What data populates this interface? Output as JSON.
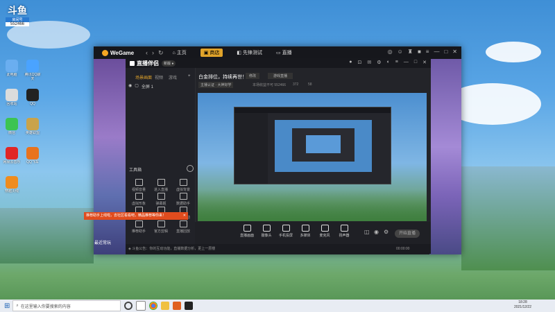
{
  "desktop": {
    "top_label": "斗鱼",
    "id_label": "房间号",
    "id_value": "552466",
    "icons": [
      {
        "label": "此电脑",
        "color": "#6aaef0"
      },
      {
        "label": "腾讯QQ聊天",
        "color": "#4aa3ff"
      },
      {
        "label": "回收站",
        "color": "#dcdcdc"
      },
      {
        "label": "QQ",
        "color": "#222222"
      },
      {
        "label": "微信",
        "color": "#3cc452"
      },
      {
        "label": "英雄联盟",
        "color": "#c9a34a"
      },
      {
        "label": "网易云音乐",
        "color": "#e02626"
      },
      {
        "label": "QQ飞车",
        "color": "#e8731e"
      },
      {
        "label": "穿越火线",
        "color": "#ef8c1e"
      }
    ],
    "right_badge": "斗鱼"
  },
  "wegame": {
    "logo": "WeGame",
    "tabs": [
      {
        "label": "主页",
        "active": false
      },
      {
        "label": "商店",
        "active": true
      },
      {
        "label": "先锋测试",
        "active": false
      },
      {
        "label": "直播",
        "active": false
      }
    ],
    "left_promo": "最近常玩"
  },
  "stream_app": {
    "logo": "直播伴侣",
    "badge": "新版 ●",
    "scene_tabs": [
      "场景画面",
      "视频",
      "游戏"
    ],
    "scene_item": "全屏 1",
    "stream_title": "白金排位，持续再世！",
    "edit_label": "修改",
    "category": "游戏直播",
    "room_info": "主播认证 · 大神好学",
    "stats": [
      "本场收益不可 552466",
      "372",
      "58"
    ],
    "tools_title": "工具箱",
    "tools": [
      {
        "label": "视频音量"
      },
      {
        "label": "进入直播"
      },
      {
        "label": "虚拟背景"
      },
      {
        "label": "虚拟形象"
      },
      {
        "label": "弹幕姬"
      },
      {
        "label": "数据助手"
      },
      {
        "label": "热门活动"
      },
      {
        "label": "PK"
      },
      {
        "label": "游戏互动"
      },
      {
        "label": "推荐助手"
      },
      {
        "label": "官方剪辑"
      },
      {
        "label": "直播回放"
      }
    ],
    "toast": "推荐助手上线啦，去社区看看吧，精品推荐等你来！",
    "bottom_buttons": [
      "直播画面",
      "摄像头",
      "手机投屏",
      "多媒体",
      "麦克风",
      "扬声器"
    ],
    "start_label": "开始直播",
    "timer": "00:00:00",
    "status": "斗鱼公告：你的互动功能，直播数据分析，更上一层楼"
  },
  "taskbar": {
    "search_placeholder": "在这里输入你要搜索的内容",
    "time": "18:28",
    "date": "2021/12/22"
  }
}
